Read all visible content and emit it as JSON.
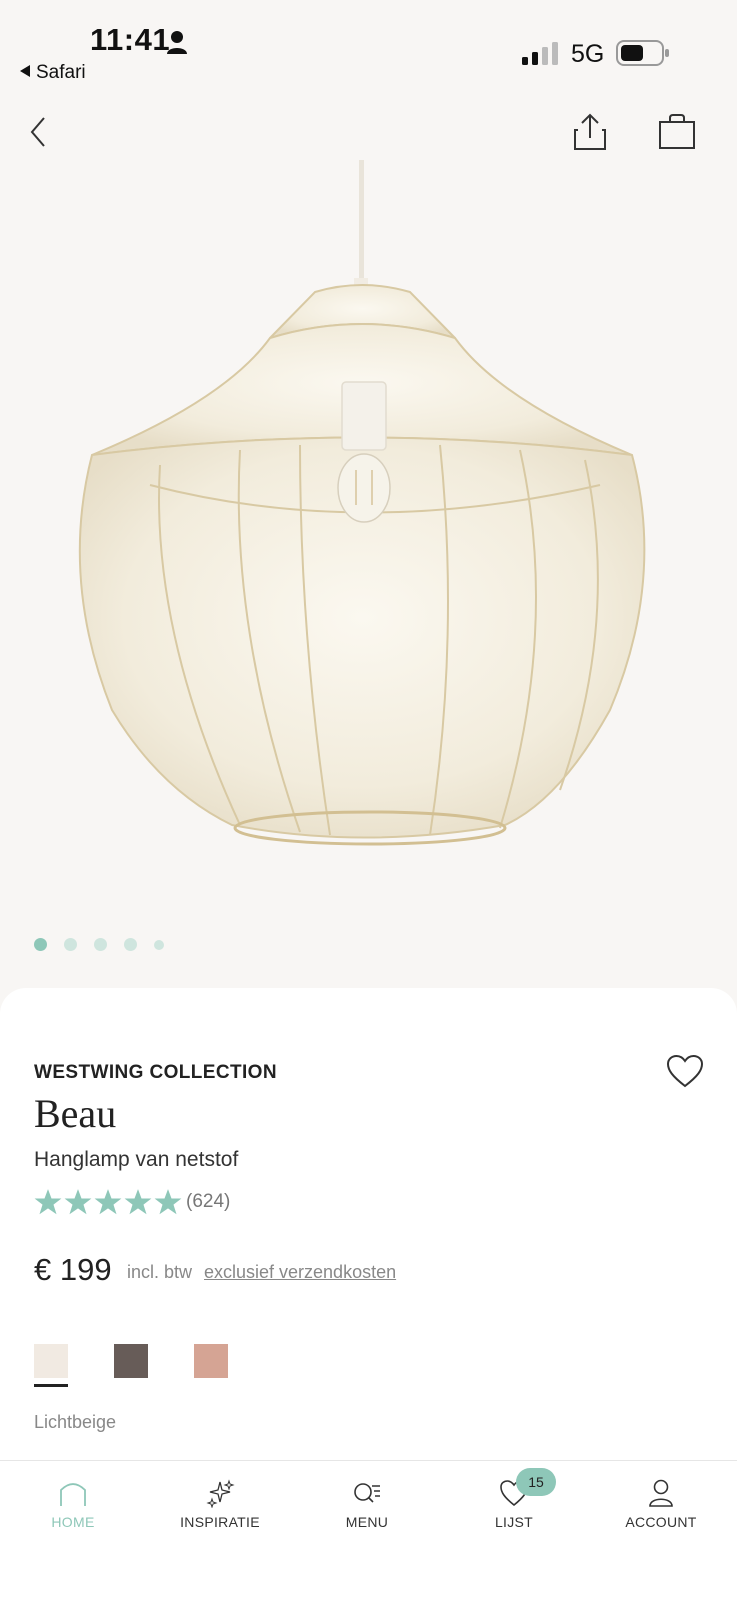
{
  "status_bar": {
    "time": "11:41",
    "back_app": "Safari",
    "network": "5G"
  },
  "nav": {
    "back_icon": "chevron-left-icon",
    "share_icon": "share-icon",
    "bag_icon": "shopping-bag-icon"
  },
  "gallery": {
    "image_count": 5,
    "active_index": 0
  },
  "product": {
    "brand": "WESTWING COLLECTION",
    "name": "Beau",
    "subtitle": "Hanglamp van netstof",
    "rating_stars": 5,
    "review_count": "(624)",
    "price": "€ 199",
    "vat_note": "incl. btw",
    "shipping_link": "exclusief verzendkosten",
    "colors": [
      {
        "hex": "#f1eae2"
      },
      {
        "hex": "#675c58"
      },
      {
        "hex": "#d5a494"
      }
    ],
    "selected_color_name": "Lichtbeige"
  },
  "tabs": [
    {
      "label": "HOME",
      "icon": "home-icon",
      "active": true
    },
    {
      "label": "INSPIRATIE",
      "icon": "sparkles-icon",
      "active": false
    },
    {
      "label": "MENU",
      "icon": "search-menu-icon",
      "active": false
    },
    {
      "label": "LIJST",
      "icon": "heart-icon",
      "active": false,
      "badge": "15"
    },
    {
      "label": "ACCOUNT",
      "icon": "user-icon",
      "active": false
    }
  ],
  "colors": {
    "accent": "#8ec7b8",
    "background": "#f8f6f4"
  }
}
